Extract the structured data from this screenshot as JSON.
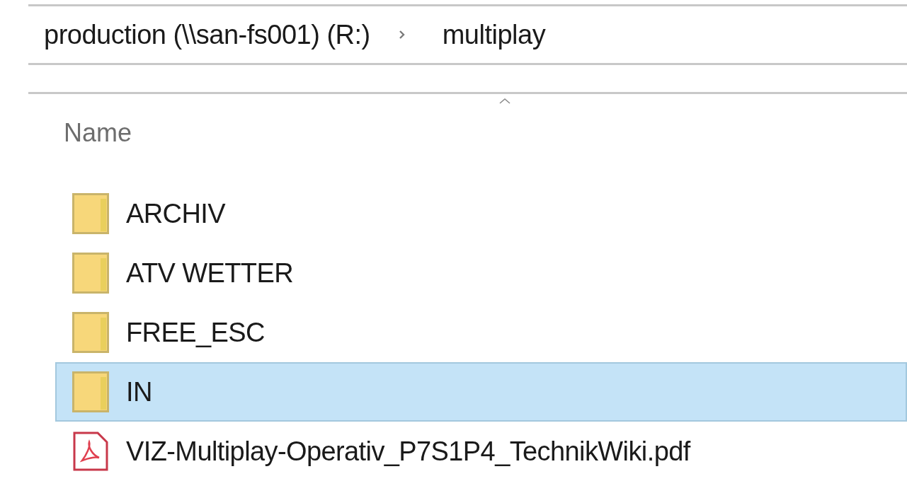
{
  "breadcrumb": [
    {
      "label": "production (\\\\san-fs001) (R:)"
    },
    {
      "label": "multiplay"
    }
  ],
  "columns": [
    {
      "label": "Name",
      "sorted": true
    }
  ],
  "files": [
    {
      "name": "ARCHIV",
      "kind": "folder",
      "selected": false
    },
    {
      "name": "ATV WETTER",
      "kind": "folder",
      "selected": false
    },
    {
      "name": "FREE_ESC",
      "kind": "folder",
      "selected": false
    },
    {
      "name": "IN",
      "kind": "folder",
      "selected": true
    },
    {
      "name": "VIZ-Multiplay-Operativ_P7S1P4_TechnikWiki.pdf",
      "kind": "pdf",
      "selected": false
    }
  ]
}
